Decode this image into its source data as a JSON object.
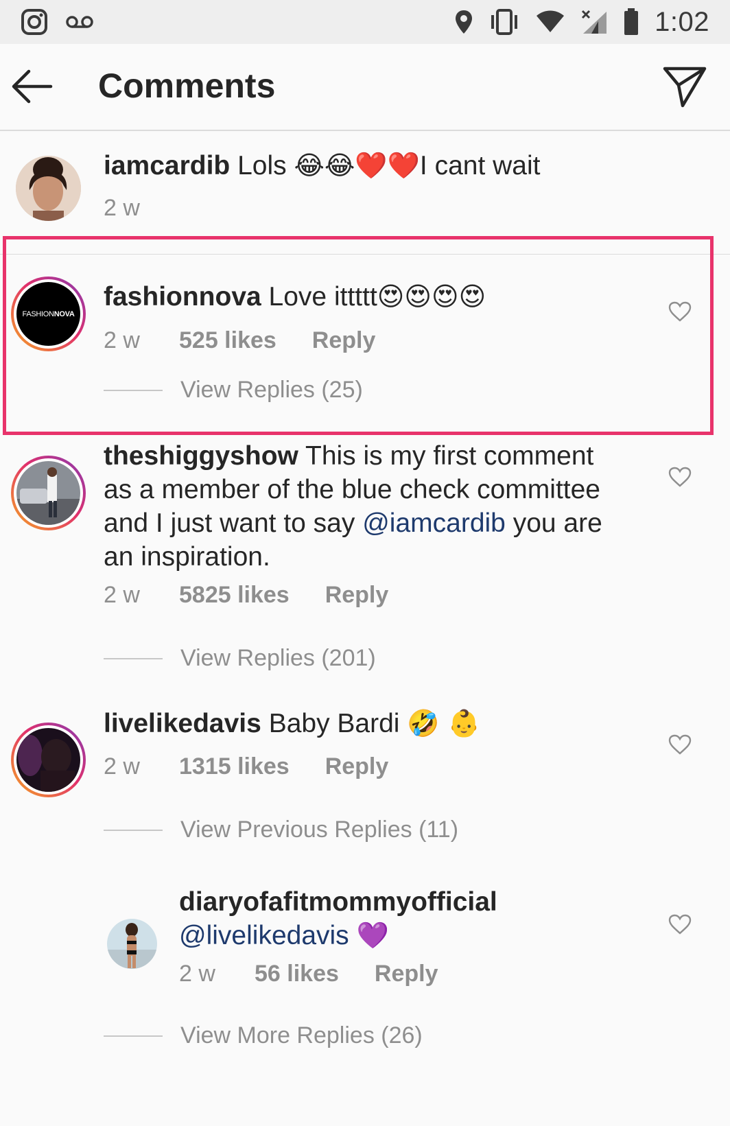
{
  "status_bar": {
    "time": "1:02",
    "left_icons": [
      "instagram-icon",
      "voicemail-icon"
    ],
    "right_icons": [
      "location-icon",
      "vibrate-icon",
      "wifi-icon",
      "no-signal-icon",
      "battery-icon"
    ]
  },
  "header": {
    "title": "Comments",
    "back_icon": "arrow-left-icon",
    "share_icon": "send-icon"
  },
  "comments": [
    {
      "username": "iamcardib",
      "text": "Lols",
      "emoji": "😂😂❤️❤️",
      "text_after": "I cant wait",
      "time": "2 w"
    },
    {
      "username": "fashionnova",
      "text": "Love ittttt",
      "emoji": "😍😍😍😍",
      "time": "2 w",
      "likes": "525 likes",
      "reply": "Reply",
      "view_replies": "View Replies (25)",
      "avatar_text": "FASHION",
      "avatar_text_bold": "NOVA"
    },
    {
      "username": "theshiggyshow",
      "text_1": "This is my first comment",
      "text_2": "as a member of the blue check committee",
      "text_3": "and I just want to say",
      "mention": "@iamcardib",
      "text_4": "you are",
      "text_5": "an inspiration.",
      "time": "2 w",
      "likes": "5825 likes",
      "reply": "Reply",
      "view_replies": "View Replies (201)"
    },
    {
      "username": "livelikedavis",
      "text": "Baby Bardi",
      "emoji": "🤣 👶",
      "time": "2 w",
      "likes": "1315 likes",
      "reply": "Reply",
      "view_replies": "View Previous Replies (11)"
    },
    {
      "username": "diaryofafitmommyofficial",
      "mention": "@livelikedavis",
      "emoji": "💜",
      "time": "2 w",
      "likes": "56 likes",
      "reply": "Reply",
      "view_replies": "View More Replies (26)"
    }
  ],
  "colors": {
    "highlight_border": "#e8336b",
    "mention": "#1e3a6d",
    "muted": "#8e8e8e"
  }
}
